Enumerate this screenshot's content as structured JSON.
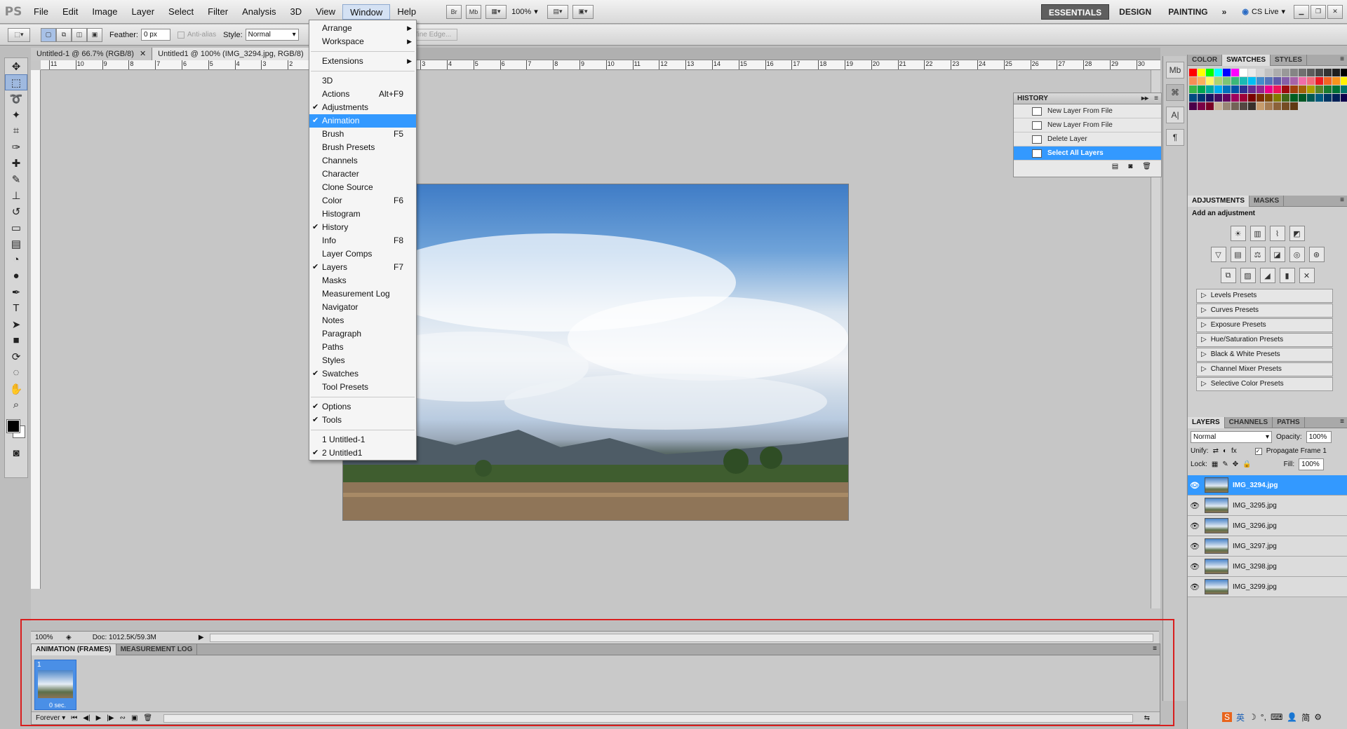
{
  "app": {
    "logo": "PS"
  },
  "menubar": {
    "items": [
      "File",
      "Edit",
      "Image",
      "Layer",
      "Select",
      "Filter",
      "Analysis",
      "3D",
      "View",
      "Window",
      "Help"
    ],
    "active": "Window",
    "bridge_label": "Br",
    "minibridge_label": "Mb",
    "zoom": "100%",
    "workspaces": [
      "ESSENTIALS",
      "DESIGN",
      "PAINTING"
    ],
    "more": "»",
    "cslive": "CS Live"
  },
  "options": {
    "feather_label": "Feather:",
    "feather_value": "0 px",
    "antialias_label": "Anti-alias",
    "style_label": "Style:",
    "style_value": "Normal",
    "refine_edge": "Refine Edge..."
  },
  "tabs": [
    {
      "label": "Untitled-1 @ 66.7% (RGB/8)"
    },
    {
      "label": "Untitled1 @ 100% (IMG_3294.jpg, RGB/8)"
    }
  ],
  "ruler_numbers": [
    "11",
    "10",
    "9",
    "8",
    "7",
    "6",
    "5",
    "4",
    "3",
    "2",
    "1",
    "0",
    "1",
    "2",
    "3",
    "4",
    "5",
    "6",
    "7",
    "8",
    "9",
    "10",
    "11",
    "12",
    "13",
    "14",
    "15",
    "16",
    "17",
    "18",
    "19",
    "20",
    "21",
    "22",
    "23",
    "24",
    "25",
    "26",
    "27",
    "28",
    "29",
    "30"
  ],
  "window_menu": {
    "items": [
      {
        "label": "Arrange",
        "arrow": true
      },
      {
        "label": "Workspace",
        "arrow": true
      },
      {
        "sep": true
      },
      {
        "label": "Extensions",
        "arrow": true
      },
      {
        "sep": true
      },
      {
        "label": "3D"
      },
      {
        "label": "Actions",
        "shortcut": "Alt+F9"
      },
      {
        "label": "Adjustments",
        "checked": true
      },
      {
        "label": "Animation",
        "checked": true,
        "highlighted": true
      },
      {
        "label": "Brush",
        "shortcut": "F5"
      },
      {
        "label": "Brush Presets"
      },
      {
        "label": "Channels"
      },
      {
        "label": "Character"
      },
      {
        "label": "Clone Source"
      },
      {
        "label": "Color",
        "shortcut": "F6"
      },
      {
        "label": "Histogram"
      },
      {
        "label": "History",
        "checked": true
      },
      {
        "label": "Info",
        "shortcut": "F8"
      },
      {
        "label": "Layer Comps"
      },
      {
        "label": "Layers",
        "checked": true,
        "shortcut": "F7"
      },
      {
        "label": "Masks"
      },
      {
        "label": "Measurement Log"
      },
      {
        "label": "Navigator"
      },
      {
        "label": "Notes"
      },
      {
        "label": "Paragraph"
      },
      {
        "label": "Paths"
      },
      {
        "label": "Styles"
      },
      {
        "label": "Swatches",
        "checked": true
      },
      {
        "label": "Tool Presets"
      },
      {
        "sep": true
      },
      {
        "label": "Options",
        "checked": true
      },
      {
        "label": "Tools",
        "checked": true
      },
      {
        "sep": true
      },
      {
        "label": "1 Untitled-1"
      },
      {
        "label": "2 Untitled1",
        "checked": true
      }
    ]
  },
  "history": {
    "title": "HISTORY",
    "rows": [
      {
        "label": "New Layer From File"
      },
      {
        "label": "New Layer From File"
      },
      {
        "label": "Delete Layer"
      },
      {
        "label": "Select All Layers",
        "selected": true
      }
    ]
  },
  "color_panel": {
    "tabs": [
      "COLOR",
      "SWATCHES",
      "STYLES"
    ],
    "active": "SWATCHES"
  },
  "swatches": [
    "#ff0000",
    "#ffff00",
    "#00ff00",
    "#00ffff",
    "#0000ff",
    "#ff00ff",
    "#ffffff",
    "#ebebeb",
    "#d6d6d6",
    "#c2c2c2",
    "#adadad",
    "#999999",
    "#858585",
    "#707070",
    "#5c5c5c",
    "#474747",
    "#333333",
    "#1f1f1f",
    "#000000",
    "#f26c4f",
    "#f68e56",
    "#fbaf5d",
    "#fff568",
    "#acd372",
    "#7cc576",
    "#3bb878",
    "#1abbb4",
    "#00bff3",
    "#438ccb",
    "#5574b9",
    "#605ca8",
    "#855fa8",
    "#a763a8",
    "#f06ea9",
    "#f26d7d",
    "#ed1c24",
    "#f26522",
    "#f7941d",
    "#fff200",
    "#8dc63f",
    "#39b54a",
    "#00a651",
    "#00a99d",
    "#00aeef",
    "#0072bc",
    "#0054a6",
    "#2e3192",
    "#662d91",
    "#92278f",
    "#ec008c",
    "#ed145b",
    "#9e0b0f",
    "#a0410d",
    "#a36209",
    "#aba000",
    "#598527",
    "#1a7b30",
    "#007236",
    "#00746b",
    "#0076a3",
    "#004b80",
    "#003471",
    "#1b1464",
    "#440e62",
    "#630460",
    "#9e005d",
    "#9e0039",
    "#790000",
    "#7b2e00",
    "#7d4900",
    "#827b00",
    "#406618",
    "#005e20",
    "#005826",
    "#005952",
    "#005b7f",
    "#003663",
    "#002157",
    "#0d004c",
    "#32004b",
    "#4b0049",
    "#7b0046",
    "#7a0026",
    "#c7b299",
    "#998675",
    "#736357",
    "#534741",
    "#37302a",
    "#c69c6d",
    "#a67c52",
    "#8c6239",
    "#754c24",
    "#603913"
  ],
  "adjustments": {
    "tabs": [
      "ADJUSTMENTS",
      "MASKS"
    ],
    "title": "Add an adjustment",
    "presets": [
      "Levels Presets",
      "Curves Presets",
      "Exposure Presets",
      "Hue/Saturation Presets",
      "Black & White Presets",
      "Channel Mixer Presets",
      "Selective Color Presets"
    ]
  },
  "layers": {
    "tabs": [
      "LAYERS",
      "CHANNELS",
      "PATHS"
    ],
    "blend": "Normal",
    "opacity_label": "Opacity:",
    "opacity": "100%",
    "unify_label": "Unify:",
    "propagate": "Propagate Frame 1",
    "lock_label": "Lock:",
    "fill_label": "Fill:",
    "fill": "100%",
    "rows": [
      {
        "name": "IMG_3294.jpg",
        "selected": true
      },
      {
        "name": "IMG_3295.jpg"
      },
      {
        "name": "IMG_3296.jpg"
      },
      {
        "name": "IMG_3297.jpg"
      },
      {
        "name": "IMG_3298.jpg"
      },
      {
        "name": "IMG_3299.jpg"
      }
    ]
  },
  "status": {
    "zoom": "100%",
    "doc": "Doc: 1012.5K/59.3M"
  },
  "animation": {
    "tabs": [
      "ANIMATION (FRAMES)",
      "MEASUREMENT LOG"
    ],
    "frame_number": "1",
    "frame_delay": "0 sec.",
    "loop": "Forever"
  },
  "taskbar": {
    "ime": "英"
  },
  "colors": {
    "accent": "#3399ff",
    "highlight_box": "#d81e1e"
  }
}
